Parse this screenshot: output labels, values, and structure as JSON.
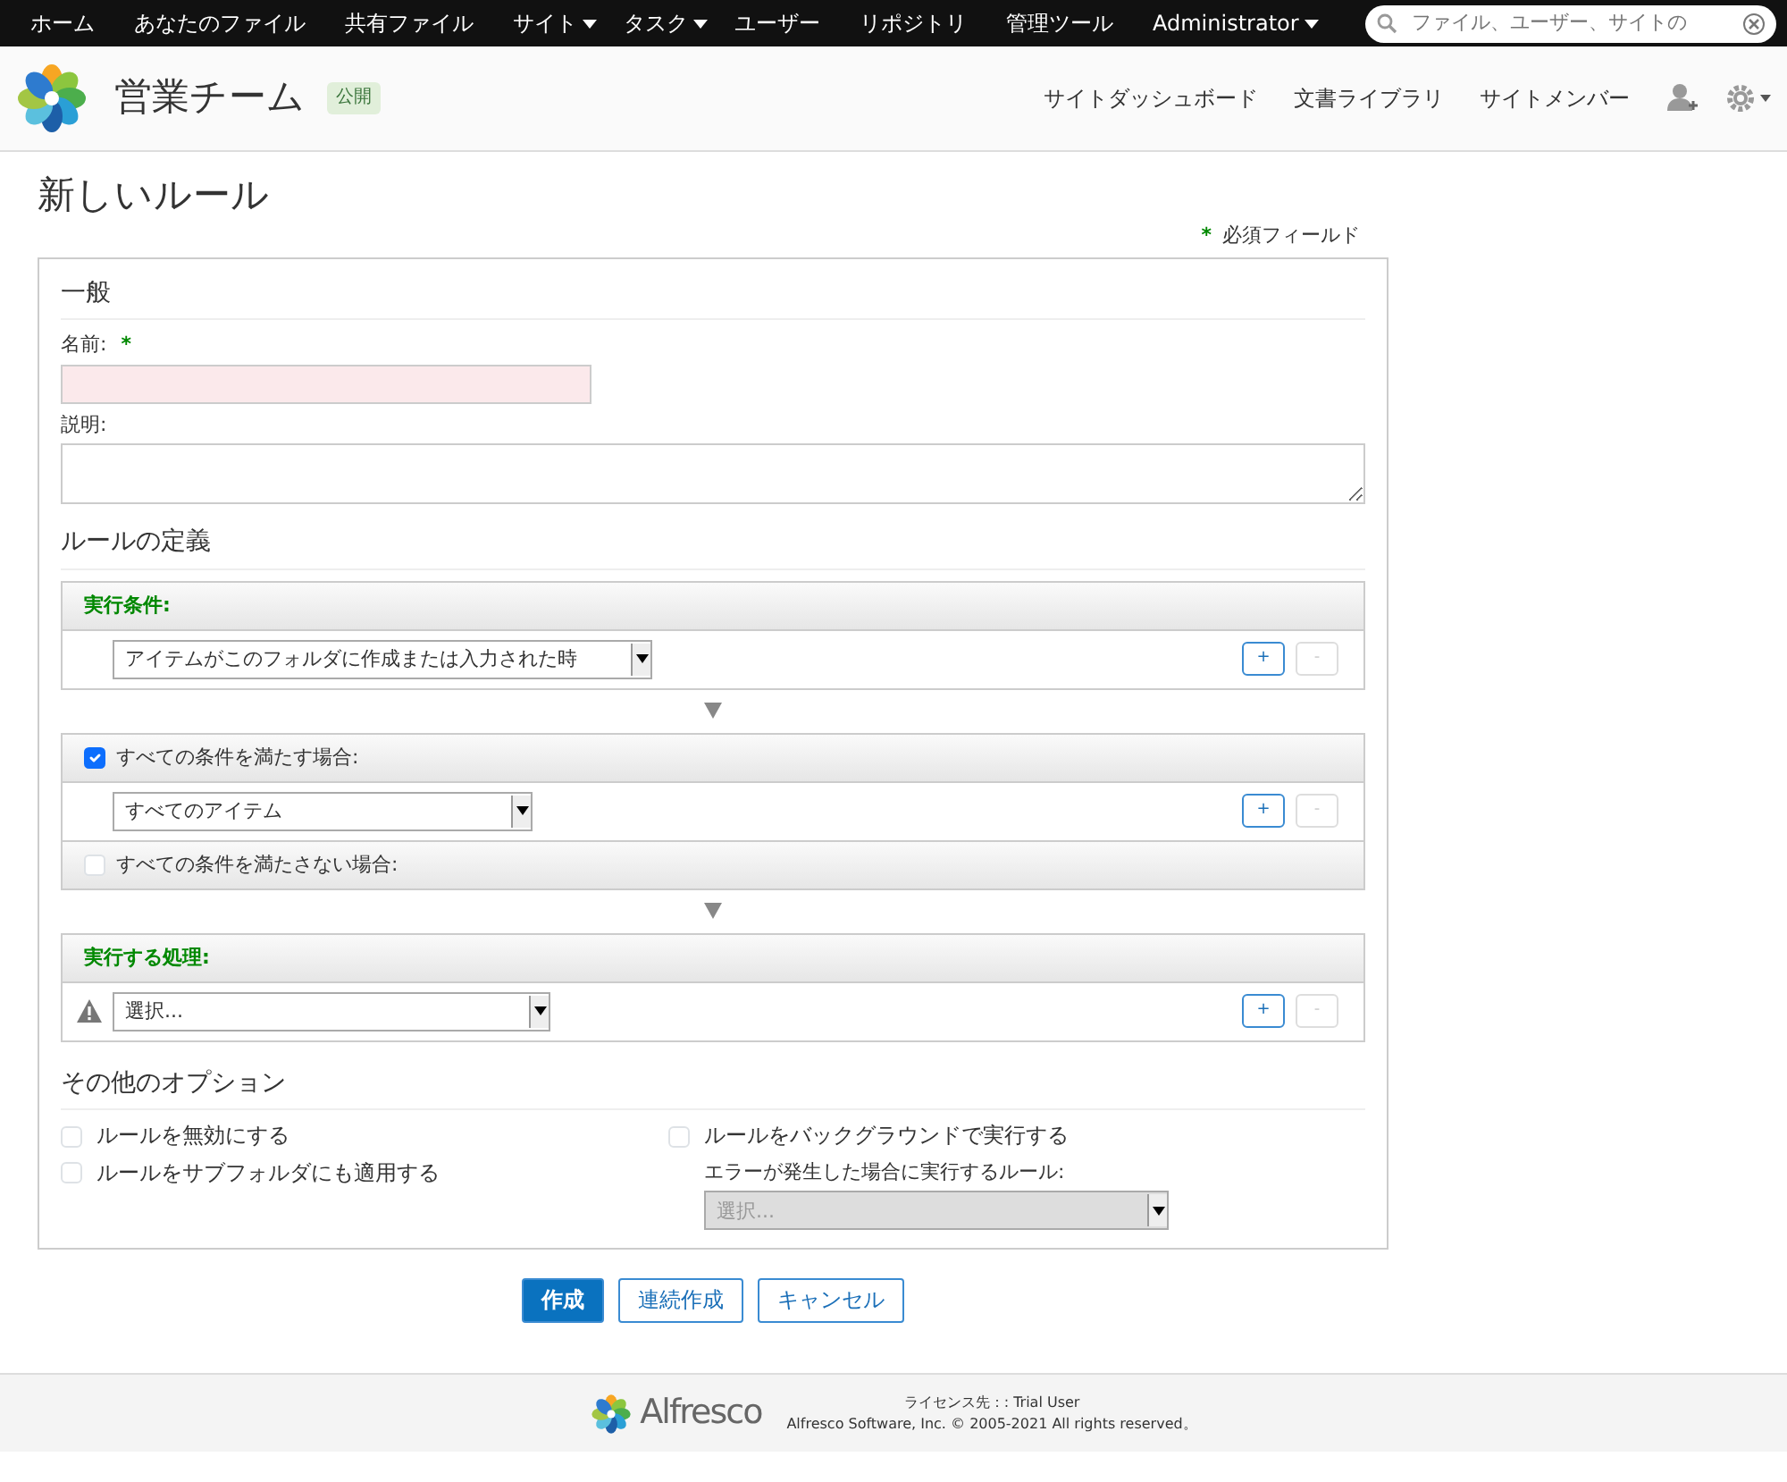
{
  "top_nav": {
    "items": [
      {
        "label": "ホーム",
        "dropdown": false
      },
      {
        "label": "あなたのファイル",
        "dropdown": false
      },
      {
        "label": "共有ファイル",
        "dropdown": false
      },
      {
        "label": "サイト",
        "dropdown": true
      },
      {
        "label": "タスク",
        "dropdown": true
      },
      {
        "label": "ユーザー",
        "dropdown": false
      },
      {
        "label": "リポジトリ",
        "dropdown": false
      },
      {
        "label": "管理ツール",
        "dropdown": false
      },
      {
        "label": "Administrator",
        "dropdown": true
      }
    ],
    "search": {
      "placeholder": "ファイル、ユーザー、サイトの"
    }
  },
  "site_header": {
    "title": "営業チーム",
    "badge": "公開",
    "links": [
      "サイトダッシュボード",
      "文書ライブラリ",
      "サイトメンバー"
    ]
  },
  "page_title": "新しいルール",
  "required_note": {
    "mark": "*",
    "label": "必須フィールド"
  },
  "general": {
    "heading": "一般",
    "name_label": "名前:",
    "name_required": true,
    "name_invalid": true,
    "description_label": "説明:"
  },
  "rule_definition": {
    "heading": "ルールの定義",
    "blocks": [
      {
        "kind": "header",
        "title": "実行条件:",
        "select": "アイテムがこのフォルダに作成または入力された時",
        "warning": false,
        "add": "+",
        "remove": "-",
        "remove_disabled": true
      },
      {
        "kind": "check",
        "title": "すべての条件を満たす場合:",
        "checked": true,
        "select": "すべてのアイテム",
        "warning": false,
        "add": "+",
        "remove": "-",
        "remove_disabled": true
      },
      {
        "kind": "check",
        "title": "すべての条件を満たさない場合:",
        "checked": false
      },
      {
        "kind": "header",
        "title": "実行する処理:",
        "select": "選択...",
        "warning": true,
        "add": "+",
        "remove": "-",
        "remove_disabled": true
      }
    ]
  },
  "other_options": {
    "heading": "その他のオプション",
    "left": [
      {
        "label": "ルールを無効にする",
        "checked": false
      },
      {
        "label": "ルールをサブフォルダにも適用する",
        "checked": false
      }
    ],
    "background": {
      "label": "ルールをバックグラウンドで実行する",
      "checked": false
    },
    "error_rule_label": "エラーが発生した場合に実行するルール:",
    "error_rule_select": {
      "value": "選択...",
      "disabled": true
    }
  },
  "buttons": [
    {
      "label": "作成",
      "primary": true
    },
    {
      "label": "連続作成",
      "primary": false
    },
    {
      "label": "キャンセル",
      "primary": false
    }
  ],
  "footer": {
    "logo_text": "Alfresco",
    "license": "ライセンス先：: Trial User",
    "copyright": "Alfresco Software, Inc. © 2005-2021 All rights reserved。"
  }
}
